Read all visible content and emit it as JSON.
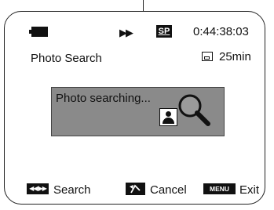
{
  "status_bar": {
    "battery_icon": "battery-icon",
    "transport_icon": "fast-forward-icon",
    "transport_symbol": "▶▶",
    "record_mode": "SP",
    "timecode": "0:44:38:03"
  },
  "info": {
    "mode_title": "Photo Search",
    "tape_icon": "tape-cassette-icon",
    "tape_remaining": "25min"
  },
  "message": {
    "text": "Photo searching...",
    "icon": "photo-search-icon"
  },
  "bottom_bar": {
    "search": {
      "button_symbol": "◀◀/▶▶",
      "label": "Search"
    },
    "cancel": {
      "button_icon": "back-arrow-icon",
      "label": "Cancel"
    },
    "exit": {
      "button_text": "MENU",
      "label": "Exit"
    }
  },
  "colors": {
    "screen_bg": "#ffffff",
    "message_box": "#8a8a8a",
    "ink": "#111111"
  }
}
